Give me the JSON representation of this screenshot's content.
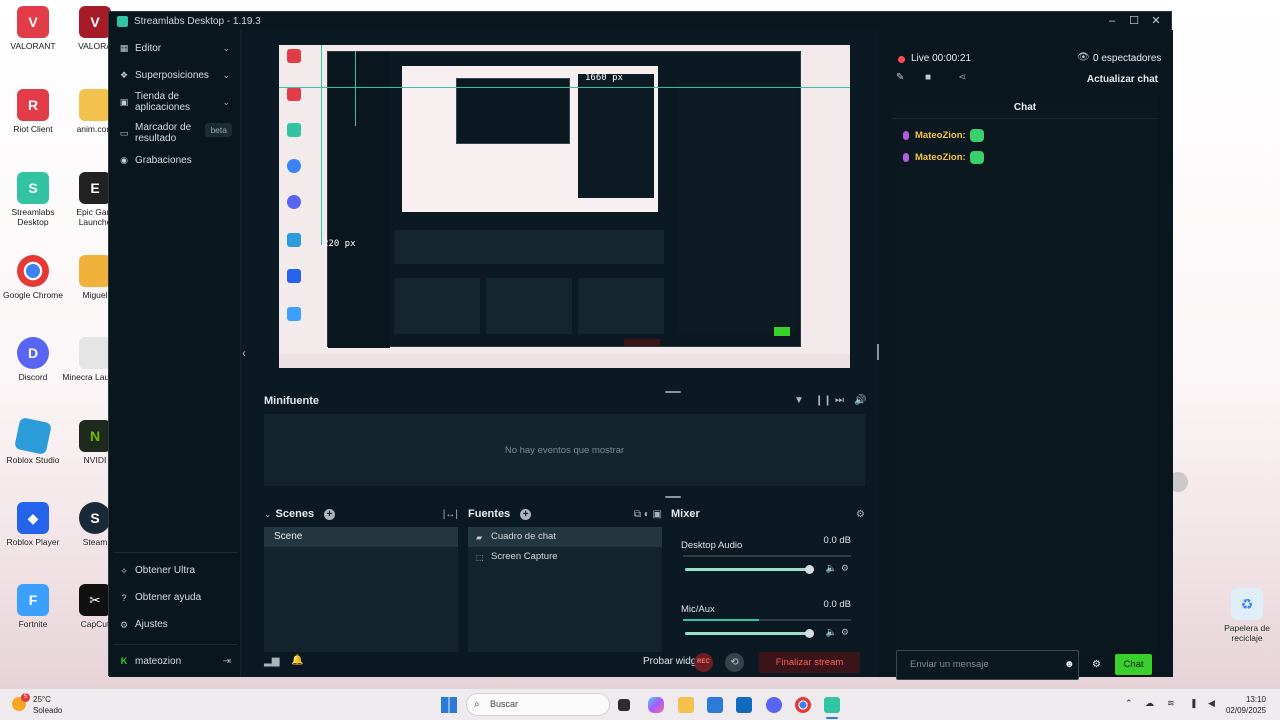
{
  "desktop": {
    "icons": [
      {
        "label": "VALORANT",
        "color": "#e13c48"
      },
      {
        "label": "VALORA",
        "color": "#a61b28"
      },
      {
        "label": "Riot Client",
        "color": "#e13c48"
      },
      {
        "label": "anim.com",
        "color": "#f2c14e"
      },
      {
        "label": "Streamlabs Desktop",
        "color": "#31c3a2"
      },
      {
        "label": "Epic Gam Launche",
        "color": "#222222"
      },
      {
        "label": "Google Chrome",
        "color": "#3b82f6"
      },
      {
        "label": "Miguel",
        "color": "#f0b23a"
      },
      {
        "label": "Discord",
        "color": "#5865f2"
      },
      {
        "label": "Minecra Launche",
        "color": "#e5e5e5"
      },
      {
        "label": "Roblox Studio",
        "color": "#2d9cdb"
      },
      {
        "label": "NVIDI",
        "color": "#1f2a1f"
      },
      {
        "label": "Roblox Player",
        "color": "#2563eb"
      },
      {
        "label": "Steam",
        "color": "#1b2838"
      },
      {
        "label": "Fortnite",
        "color": "#3ba0ff"
      },
      {
        "label": "CapCut",
        "color": "#111111"
      }
    ],
    "recycle_bin": "Papelera de reciclaje"
  },
  "window": {
    "title": "Streamlabs Desktop - 1.19.3"
  },
  "nav": {
    "items": [
      {
        "label": "Editor",
        "icon": "editor-icon",
        "chevron": "⌄"
      },
      {
        "label": "Superposiciones",
        "icon": "overlays-icon",
        "chevron": "⌄"
      },
      {
        "label": "Tienda de aplicaciones",
        "icon": "store-icon",
        "chevron": "⌄"
      },
      {
        "label": "Marcador de resultado",
        "icon": "scoreboard-icon",
        "badge": "beta"
      },
      {
        "label": "Grabaciones",
        "icon": "recordings-icon"
      }
    ],
    "bottom": [
      {
        "label": "Obtener Ultra",
        "icon": "ultra-icon"
      },
      {
        "label": "Obtener ayuda",
        "icon": "help-icon"
      },
      {
        "label": "Ajustes",
        "icon": "gear-icon"
      }
    ],
    "user": "mateozion"
  },
  "preview": {
    "width_label": "1660 px",
    "height_label": "220 px"
  },
  "minifuente": {
    "title": "Minifuente",
    "empty": "No hay eventos que mostrar"
  },
  "scenes": {
    "title": "Scenes",
    "items": [
      "Scene"
    ]
  },
  "sources": {
    "title": "Fuentes",
    "items": [
      {
        "label": "Cuadro de chat",
        "icon": "chat-icon"
      },
      {
        "label": "Screen Capture",
        "icon": "screen-capture-icon"
      }
    ]
  },
  "mixer": {
    "title": "Mixer",
    "channels": [
      {
        "name": "Desktop Audio",
        "db": "0.0 dB",
        "level": 0.0,
        "volume": 1.0
      },
      {
        "name": "Mic/Aux",
        "db": "0.0 dB",
        "level": 0.45,
        "volume": 1.0
      }
    ]
  },
  "footer": {
    "test_widgets": "Probar widgets",
    "rec": "REC",
    "end_stream": "Finalizar stream"
  },
  "right": {
    "live": "Live 00:00:21",
    "viewers": "0 espectadores",
    "refresh_chat": "Actualizar chat",
    "chat_title": "Chat",
    "messages": [
      {
        "user": "MateoZion:"
      },
      {
        "user": "MateoZion:"
      }
    ],
    "input_placeholder": "Enviar un mensaje",
    "send": "Chat"
  },
  "taskbar": {
    "temp": "25°C",
    "weather": "Soleado",
    "weather_badge": "5",
    "search": "Buscar",
    "time": "13:10",
    "date": "02/09/2025"
  },
  "colors": {
    "accent": "#31c3a2",
    "live": "#ff4d4d",
    "chat_button": "#3ad02b",
    "username": "#f2c24a"
  }
}
